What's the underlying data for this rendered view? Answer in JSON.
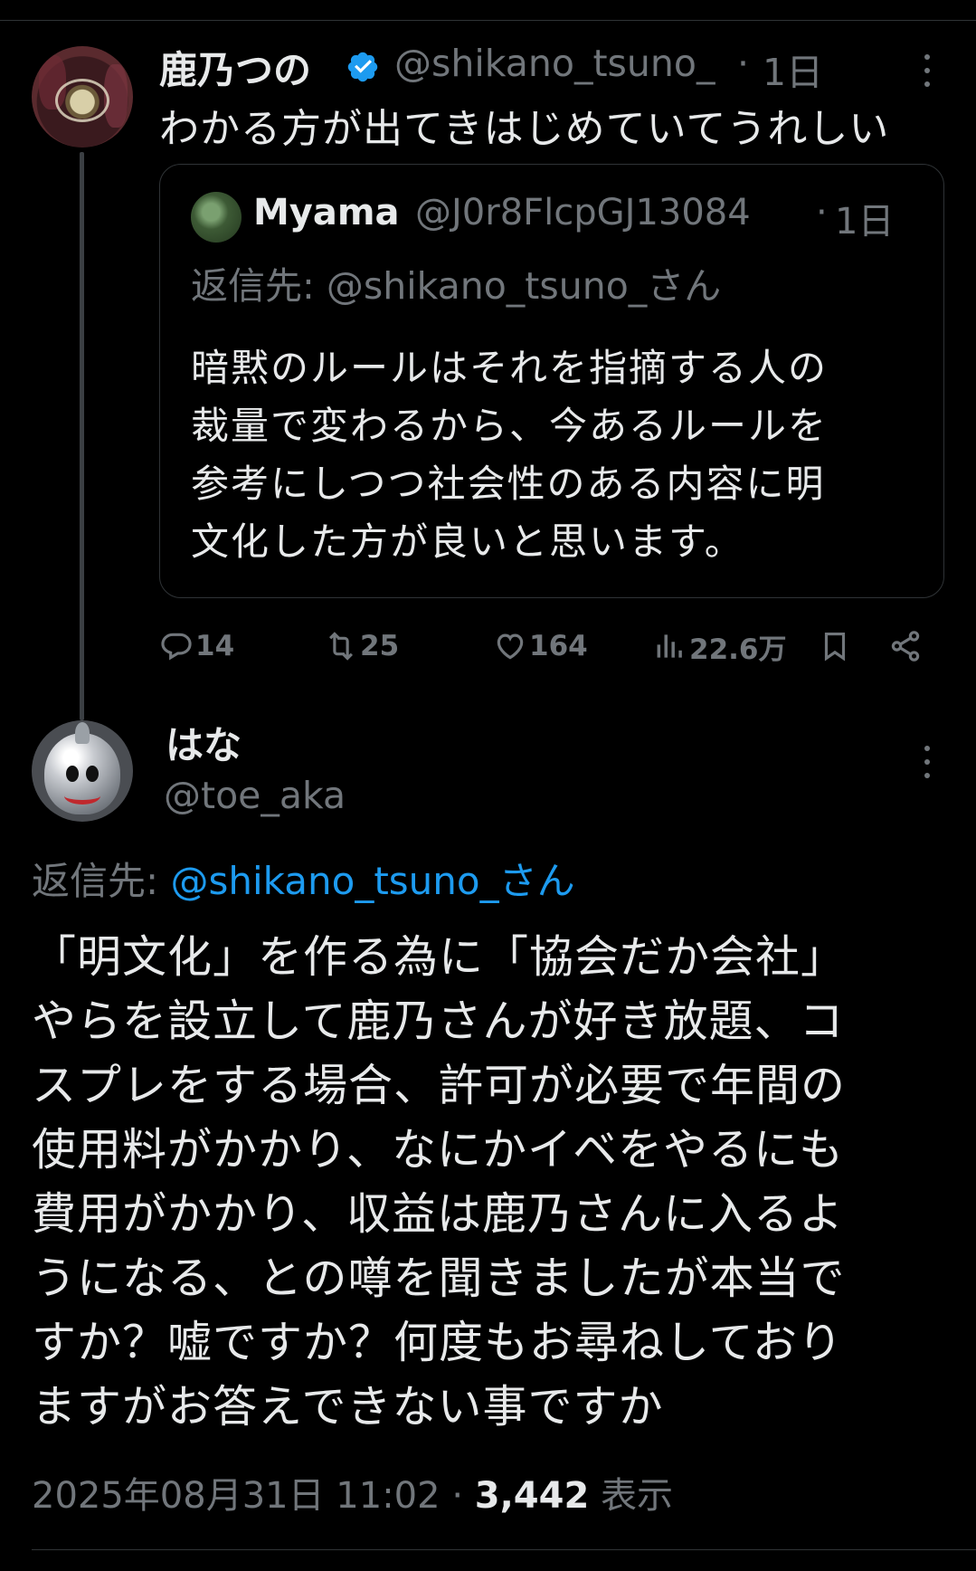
{
  "main_tweet": {
    "name": "鹿乃つの",
    "handle": "@shikano_tsuno_",
    "separator": "·",
    "time": "1日",
    "text": "わかる方が出てきはじめていてうれしい",
    "verified_icon": "verified-badge-icon"
  },
  "quoted_tweet": {
    "name": "Myama",
    "handle": "@J0r8FlcpGJ13084",
    "separator": "·",
    "time": "1日",
    "reply_to": "返信先: @shikano_tsuno_さん",
    "body_lines": [
      "暗黙のルールはそれを指摘する人の",
      "裁量で変わるから、今あるルールを",
      "参考にしつつ社会性のある内容に明",
      "文化した方が良いと思います。"
    ]
  },
  "actions": {
    "replies": "14",
    "reposts": "25",
    "likes": "164",
    "views": "22.6万",
    "colors": {
      "icon": "#71767b"
    }
  },
  "reply_tweet": {
    "name": "はな",
    "handle": "@toe_aka",
    "reply_prefix": "返信先: ",
    "reply_link": "@shikano_tsuno_さん",
    "body_lines": [
      "「明文化」を作る為に「協会だか会社」",
      "やらを設立して鹿乃さんが好き放題、コ",
      "スプレをする場合、許可が必要で年間の",
      "使用料がかかり、なにかイベをやるにも",
      "費用がかかり、収益は鹿乃さんに入るよ",
      "うになる、との噂を聞きましたが本当で",
      "すか？嘘ですか？何度もお尋ねしており",
      "ますがお答えできない事ですか"
    ],
    "timestamp": "2025年08月31日 11:02",
    "separator": "·",
    "view_count": "3,442",
    "view_label": "表示"
  },
  "theme": {
    "background": "#000000",
    "text": "#e7e9ea",
    "muted": "#71767b",
    "accent": "#1d9bf0",
    "border": "#2f3336"
  }
}
